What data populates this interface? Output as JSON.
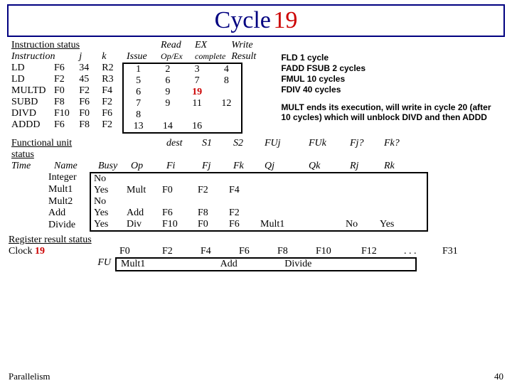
{
  "title": {
    "label": "Cycle",
    "num": "19"
  },
  "instr": {
    "heading": "Instruction status",
    "cols_left": [
      "Instruction",
      "j",
      "k"
    ],
    "cols_right": [
      "Issue",
      "Op/Ex",
      "complete",
      "Result"
    ],
    "top_labels": {
      "read": "Read",
      "ex": "EX",
      "write": "Write"
    },
    "rows": [
      {
        "op": "LD",
        "d": "F6",
        "j": "34",
        "k": "R2",
        "issue": "1",
        "opex": "2",
        "comp": "3",
        "res": "4"
      },
      {
        "op": "LD",
        "d": "F2",
        "j": "45",
        "k": "R3",
        "issue": "5",
        "opex": "6",
        "comp": "7",
        "res": "8"
      },
      {
        "op": "MULTD",
        "d": "F0",
        "j": "F2",
        "k": "F4",
        "issue": "6",
        "opex": "9",
        "comp": "19",
        "res": ""
      },
      {
        "op": "SUBD",
        "d": "F8",
        "j": "F6",
        "k": "F2",
        "issue": "7",
        "opex": "9",
        "comp": "11",
        "res": "12"
      },
      {
        "op": "DIVD",
        "d": "F10",
        "j": "F0",
        "k": "F6",
        "issue": "8",
        "opex": "",
        "comp": "",
        "res": ""
      },
      {
        "op": "ADDD",
        "d": "F6",
        "j": "F8",
        "k": "F2",
        "issue": "13",
        "opex": "14",
        "comp": "16",
        "res": ""
      }
    ]
  },
  "latencies": [
    "FLD    1 cycle",
    "FADD  FSUB 2 cycles",
    "FMUL 10 cycles",
    "FDIV   40 cycles"
  ],
  "note": "MULT ends its execution, will write in cycle 20 (after   10 cycles) which will unblock DIVD and then ADDD",
  "fu": {
    "heading": "Functional unit status",
    "cols": [
      "Time",
      "Name",
      "Busy",
      "Op",
      "Fi",
      "Fj",
      "Fk",
      "Qj",
      "Qk",
      "Rj",
      "Rk"
    ],
    "group": {
      "dest": "dest",
      "s1": "S1",
      "s2": "S2",
      "fuj": "FUj",
      "fuk": "FUk",
      "fj": "Fj?",
      "fk": "Fk?"
    },
    "rows": [
      {
        "name": "Integer",
        "busy": "No",
        "op": "",
        "fi": "",
        "fj": "",
        "fk": "",
        "qj": "",
        "qk": "",
        "rj": "",
        "rk": ""
      },
      {
        "name": "Mult1",
        "busy": "Yes",
        "op": "Mult",
        "fi": "F0",
        "fj": "F2",
        "fk": "F4",
        "qj": "",
        "qk": "",
        "rj": "",
        "rk": ""
      },
      {
        "name": "Mult2",
        "busy": "No",
        "op": "",
        "fi": "",
        "fj": "",
        "fk": "",
        "qj": "",
        "qk": "",
        "rj": "",
        "rk": ""
      },
      {
        "name": "Add",
        "busy": "Yes",
        "op": "Add",
        "fi": "F6",
        "fj": "F8",
        "fk": "F2",
        "qj": "",
        "qk": "",
        "rj": "",
        "rk": ""
      },
      {
        "name": "Divide",
        "busy": "Yes",
        "op": "Div",
        "fi": "F10",
        "fj": "F0",
        "fk": "F6",
        "qj": "Mult1",
        "qk": "",
        "rj": "No",
        "rk": "Yes"
      }
    ]
  },
  "reg": {
    "heading": "Register result status",
    "clock_label": "Clock",
    "clock": "19",
    "fu_label": "FU",
    "regs": [
      "F0",
      "F2",
      "F4",
      "F6",
      "F8",
      "F10",
      "F12",
      ". . .",
      "F31"
    ],
    "fu": [
      "Mult1",
      "",
      "",
      "Add",
      "",
      "Divide",
      "",
      "",
      ""
    ]
  },
  "footer": {
    "left": "Parallelism",
    "right": "40"
  }
}
